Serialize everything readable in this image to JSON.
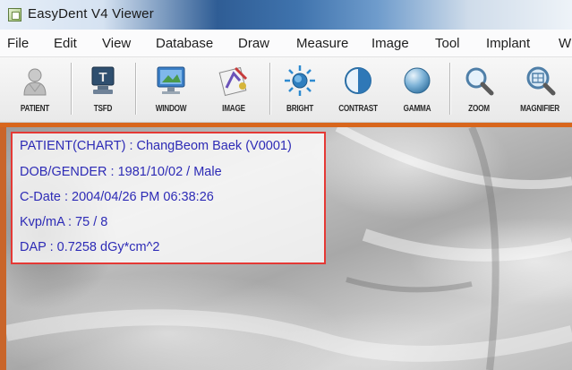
{
  "window": {
    "title": "EasyDent V4 Viewer"
  },
  "menu": [
    "File",
    "Edit",
    "View",
    "Database",
    "Draw",
    "Measure",
    "Image",
    "Tool",
    "Implant",
    "W"
  ],
  "toolbar": {
    "buttons": [
      {
        "label": "PATIENT",
        "icon": "patient-icon"
      },
      {
        "label": "TSFD",
        "icon": "tsfd-icon"
      },
      {
        "label": "WINDOW",
        "icon": "window-icon"
      },
      {
        "label": "IMAGE",
        "icon": "image-icon"
      },
      {
        "label": "BRIGHT",
        "icon": "bright-icon"
      },
      {
        "label": "CONTRAST",
        "icon": "contrast-icon"
      },
      {
        "label": "GAMMA",
        "icon": "gamma-icon"
      },
      {
        "label": "ZOOM",
        "icon": "zoom-icon"
      },
      {
        "label": "MAGNIFIER",
        "icon": "magnifier-icon"
      }
    ]
  },
  "patient_info": {
    "patient": "PATIENT(CHART) : ChangBeom Baek (V0001)",
    "dob_gender": "DOB/GENDER : 1981/10/02 / Male",
    "c_date": "C-Date : 2004/04/26 PM 06:38:26",
    "kvp_ma": "Kvp/mA :  75 /   8",
    "dap": "DAP : 0.7258 dGy*cm^2"
  },
  "colors": {
    "info_text": "#2d2bb6",
    "highlight_border": "#e53935",
    "viewer_border": "#d8661c"
  }
}
